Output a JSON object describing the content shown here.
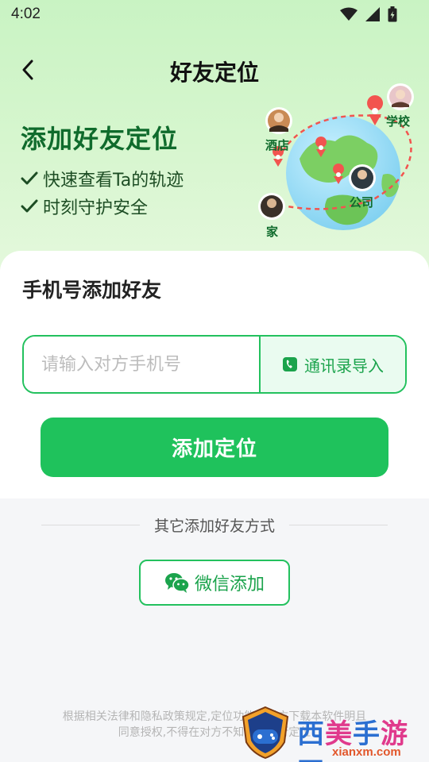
{
  "status_bar": {
    "time": "4:02"
  },
  "nav": {
    "title": "好友定位"
  },
  "hero": {
    "title": "添加好友定位",
    "features": [
      "快速查看Ta的轨迹",
      "时刻守护安全"
    ],
    "places": {
      "hotel": "酒店",
      "school": "学校",
      "company": "公司",
      "home": "家"
    }
  },
  "phone_section": {
    "title": "手机号添加好友",
    "input_placeholder": "请输入对方手机号",
    "import_label": "通讯录导入",
    "submit_label": "添加定位"
  },
  "other_section": {
    "divider_text": "其它添加好友方式",
    "wechat_label": "微信添加"
  },
  "disclaimer": {
    "line1": "根据相关法律和隐私政策规定,定位功能需对方下载本软件明且",
    "line2": "同意授权,不得在对方不知情下进行定位"
  },
  "watermark": {
    "chars": [
      "西",
      "美",
      "手",
      "游",
      "网"
    ],
    "domain": "xianxm.com"
  },
  "colors": {
    "brand_green": "#1fc25c",
    "hero_title": "#0f6b2c",
    "route_red": "#f2544f"
  },
  "icons": [
    "back-arrow-icon",
    "wifi-icon",
    "signal-icon",
    "battery-icon",
    "check-icon",
    "phone-book-icon",
    "wechat-icon",
    "location-pin-icon",
    "globe-illustration"
  ]
}
